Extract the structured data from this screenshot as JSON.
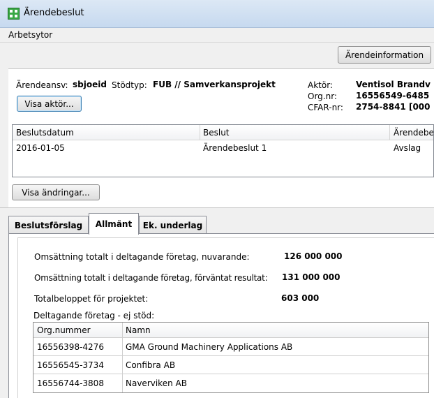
{
  "window": {
    "title": "Ärendebeslut",
    "icon": "app-grid-icon"
  },
  "menu": {
    "items": [
      "Arbetsytor"
    ]
  },
  "toolbar": {
    "info_button": "Ärendeinformation"
  },
  "case": {
    "owner_label": "Ärendeansv:",
    "owner_value": "sbjoeid",
    "type_label": "Stödtyp:",
    "type_value": "FUB // Samverkansprojekt",
    "actor_button": "Visa aktör...",
    "actor_label": "Aktör:",
    "actor_value": "Ventisol Brandv",
    "org_label": "Org.nr:",
    "org_value": "16556549-6485",
    "cfar_label": "CFAR-nr:",
    "cfar_value": "2754-8841 [000"
  },
  "decisions": {
    "headers": [
      "Beslutsdatum",
      "Beslut",
      "Ärendebe"
    ],
    "rows": [
      [
        "2016-01-05",
        "Ärendebeslut 1",
        "Avslag"
      ]
    ],
    "changes_button": "Visa ändringar..."
  },
  "tabs": [
    "Beslutsförslag",
    "Allmänt",
    "Ek. underlag"
  ],
  "active_tab": "Allmänt",
  "general": {
    "turnover_current_label": "Omsättning totalt i deltagande företag, nuvarande:",
    "turnover_current_value": "126 000 000",
    "turnover_expected_label": "Omsättning totalt i deltagande företag, förväntat resultat:",
    "turnover_expected_value": "131 000 000",
    "total_label": "Totalbeloppet för projektet:",
    "total_value": "603 000",
    "companies_label": "Deltagande företag - ej stöd:",
    "companies_headers": [
      "Org.nummer",
      "Namn"
    ],
    "companies": [
      [
        "16556398-4276",
        "GMA Ground Machinery Applications AB"
      ],
      [
        "16556545-3734",
        "Confibra AB"
      ],
      [
        "16556744-3808",
        "Naverviken AB"
      ]
    ]
  }
}
